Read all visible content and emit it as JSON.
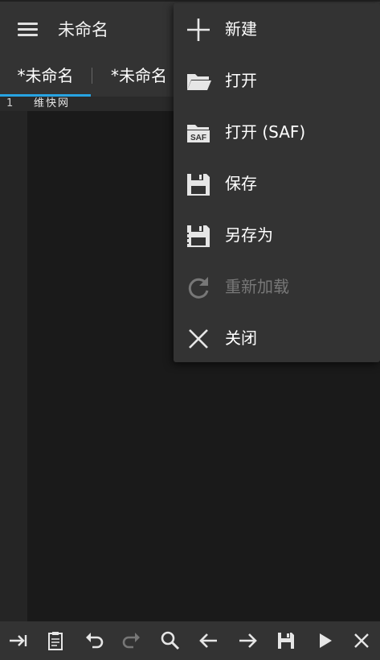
{
  "app_bar": {
    "title": "未命名"
  },
  "tabs": [
    {
      "label": "*未命名",
      "active": true
    },
    {
      "label": "*未命名",
      "active": false
    }
  ],
  "editor": {
    "line_number": "1",
    "line_text": "维快网"
  },
  "menu": {
    "items": [
      {
        "label": "新建",
        "icon": "plus-icon",
        "enabled": true
      },
      {
        "label": "打开",
        "icon": "folder-open-icon",
        "enabled": true
      },
      {
        "label": "打开 (SAF)",
        "icon": "saf-folder-icon",
        "enabled": true
      },
      {
        "label": "保存",
        "icon": "save-icon",
        "enabled": true
      },
      {
        "label": "另存为",
        "icon": "save-as-icon",
        "enabled": true
      },
      {
        "label": "重新加载",
        "icon": "reload-icon",
        "enabled": false
      },
      {
        "label": "关闭",
        "icon": "close-icon",
        "enabled": true
      }
    ]
  },
  "toolbar": {
    "buttons": [
      "tab-indent-icon",
      "clipboard-icon",
      "undo-icon",
      "redo-icon",
      "search-icon",
      "arrow-left-icon",
      "arrow-right-icon",
      "save-icon",
      "run-icon",
      "close-icon"
    ],
    "redo_enabled": false
  },
  "colors": {
    "accent": "#27a3e2",
    "bar": "#333333",
    "editor_bg": "#1a1a1a",
    "disabled": "#777777"
  }
}
